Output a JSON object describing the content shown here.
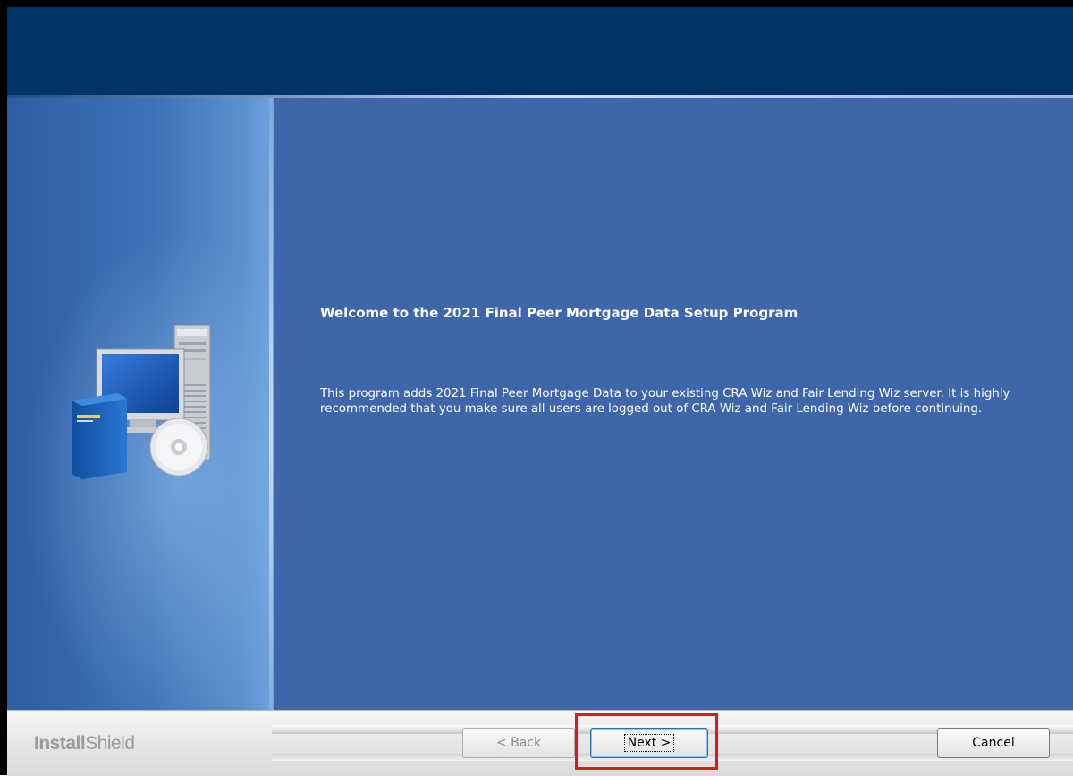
{
  "welcome": {
    "title": "Welcome to the 2021 Final Peer Mortgage Data Setup Program",
    "body": "This program adds 2021 Final Peer Mortgage Data to your existing CRA Wiz and Fair Lending Wiz server. It is highly recommended that you make sure all users are logged out of CRA Wiz and Fair Lending Wiz before continuing."
  },
  "footer": {
    "brand_part1": "Install",
    "brand_part2": "Shield",
    "back_label": "< Back",
    "next_label": "Next >",
    "cancel_label": "Cancel"
  },
  "colors": {
    "header": "#003366",
    "main_panel": "#3f66ab",
    "highlight": "#e0161f"
  },
  "icons": {
    "side_art": "computer-with-cd-icon"
  }
}
